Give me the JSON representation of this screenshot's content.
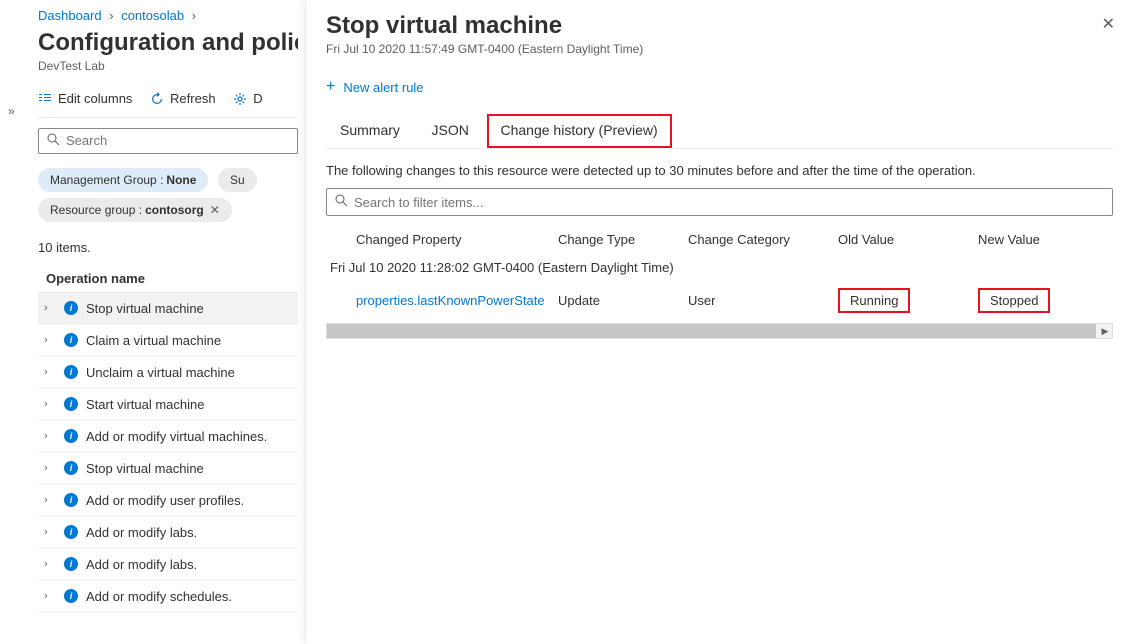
{
  "breadcrumb": {
    "items": [
      "Dashboard",
      "contosolab"
    ]
  },
  "page": {
    "title": "Configuration and policies",
    "subtitle": "DevTest Lab"
  },
  "toolbar": {
    "edit_columns": "Edit columns",
    "refresh": "Refresh",
    "third": "D"
  },
  "search": {
    "placeholder": "Search"
  },
  "filters": {
    "mg_label": "Management Group :",
    "mg_value": "None",
    "sub_label": "Su",
    "rg_label": "Resource group :",
    "rg_value": "contosorg"
  },
  "item_count": "10 items.",
  "column_header": "Operation name",
  "operations": [
    "Stop virtual machine",
    "Claim a virtual machine",
    "Unclaim a virtual machine",
    "Start virtual machine",
    "Add or modify virtual machines.",
    "Stop virtual machine",
    "Add or modify user profiles.",
    "Add or modify labs.",
    "Add or modify labs.",
    "Add or modify schedules."
  ],
  "panel": {
    "title": "Stop virtual machine",
    "subtitle": "Fri Jul 10 2020 11:57:49 GMT-0400 (Eastern Daylight Time)",
    "new_alert": "New alert rule",
    "tabs": [
      "Summary",
      "JSON",
      "Change history (Preview)"
    ],
    "note": "The following changes to this resource were detected up to 30 minutes before and after the time of the operation.",
    "filter_placeholder": "Search to filter items...",
    "headers": {
      "prop": "Changed Property",
      "type": "Change Type",
      "cat": "Change Category",
      "old": "Old Value",
      "new": "New Value"
    },
    "group_ts": "Fri Jul 10 2020 11:28:02 GMT-0400 (Eastern Daylight Time)",
    "row": {
      "prop": "properties.lastKnownPowerState",
      "type": "Update",
      "cat": "User",
      "old": "Running",
      "new": "Stopped"
    }
  }
}
